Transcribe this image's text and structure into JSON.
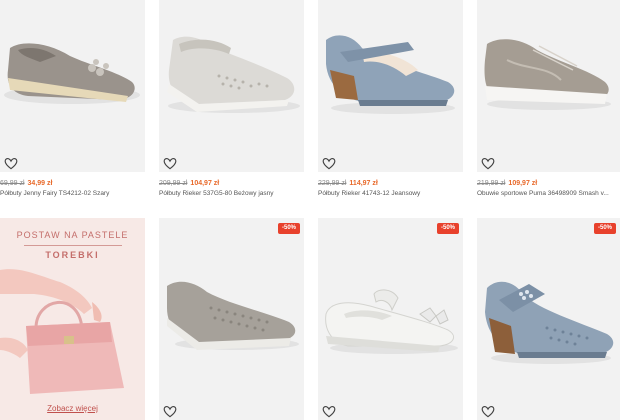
{
  "products_row1": [
    {
      "old_price": "69,99 zł",
      "new_price": "34,99 zł",
      "name": "Półbuty Jenny Fairy TS4212-02 Szary",
      "icon": "heart-outline-icon"
    },
    {
      "old_price": "209,99 zł",
      "new_price": "104,97 zł",
      "name": "Półbuty Rieker 537G5-80 Beżowy jasny",
      "icon": "heart-outline-icon"
    },
    {
      "old_price": "229,99 zł",
      "new_price": "114,97 zł",
      "name": "Półbuty Rieker 41743-12 Jeansowy",
      "icon": "heart-outline-icon"
    },
    {
      "old_price": "219,99 zł",
      "new_price": "109,97 zł",
      "name": "Obuwie sportowe Puma 36498909 Smash v...",
      "icon": "heart-outline-icon"
    }
  ],
  "products_row2": [
    {
      "badge": "-50%",
      "icon": "heart-outline-icon"
    },
    {
      "badge": "-50%",
      "icon": "heart-outline-icon"
    },
    {
      "badge": "-50%",
      "icon": "heart-outline-icon"
    }
  ],
  "promo": {
    "title": "POSTAW NA PASTELE",
    "subtitle": "TOREBKI",
    "link": "Zobacz więcej"
  },
  "colors": {
    "accent": "#e8692a",
    "badge": "#e8412c",
    "tile_bg": "#f2f2f2"
  }
}
